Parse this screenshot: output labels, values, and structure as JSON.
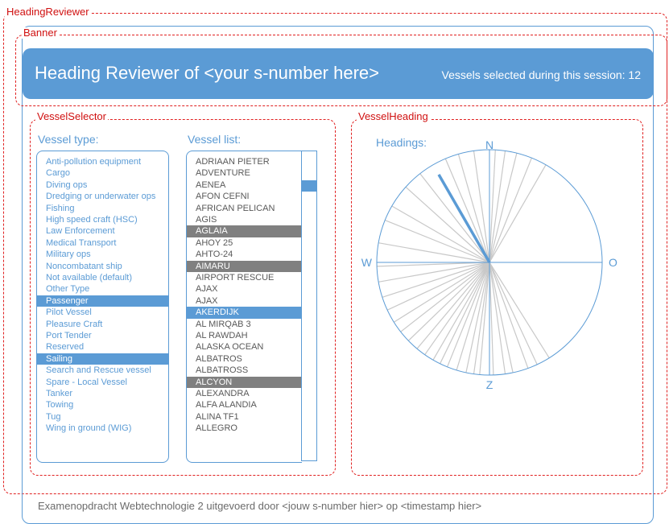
{
  "regions": {
    "outer": "HeadingReviewer",
    "banner": "Banner",
    "selector": "VesselSelector",
    "heading": "VesselHeading"
  },
  "banner": {
    "title": "Heading Reviewer of <your s-number here>",
    "session_count": "Vessels selected during this session: 12"
  },
  "selector": {
    "type_label": "Vessel type:",
    "list_label": "Vessel list:",
    "vessel_types": [
      {
        "label": "Anti-pollution equipment",
        "selected": false
      },
      {
        "label": "Cargo",
        "selected": false
      },
      {
        "label": "Diving ops",
        "selected": false
      },
      {
        "label": "Dredging or underwater ops",
        "selected": false
      },
      {
        "label": "Fishing",
        "selected": false
      },
      {
        "label": "High speed craft (HSC)",
        "selected": false
      },
      {
        "label": "Law Enforcement",
        "selected": false
      },
      {
        "label": "Medical Transport",
        "selected": false
      },
      {
        "label": "Military ops",
        "selected": false
      },
      {
        "label": "Noncombatant ship",
        "selected": false
      },
      {
        "label": "Not available (default)",
        "selected": false
      },
      {
        "label": "Other Type",
        "selected": false
      },
      {
        "label": "Passenger",
        "selected": true
      },
      {
        "label": "Pilot Vessel",
        "selected": false
      },
      {
        "label": "Pleasure Craft",
        "selected": false
      },
      {
        "label": "Port Tender",
        "selected": false
      },
      {
        "label": "Reserved",
        "selected": false
      },
      {
        "label": "Sailing",
        "selected": true
      },
      {
        "label": "Search and Rescue vessel",
        "selected": false
      },
      {
        "label": "Spare - Local Vessel",
        "selected": false
      },
      {
        "label": "Tanker",
        "selected": false
      },
      {
        "label": "Towing",
        "selected": false
      },
      {
        "label": "Tug",
        "selected": false
      },
      {
        "label": "Wing in ground (WIG)",
        "selected": false
      }
    ],
    "vessels": [
      {
        "name": "ADRIAAN PIETER",
        "state": "none"
      },
      {
        "name": "ADVENTURE",
        "state": "none"
      },
      {
        "name": "AENEA",
        "state": "none"
      },
      {
        "name": "AFON CEFNI",
        "state": "none"
      },
      {
        "name": "AFRICAN PELICAN",
        "state": "none"
      },
      {
        "name": "AGIS",
        "state": "none"
      },
      {
        "name": "AGLAIA",
        "state": "selected"
      },
      {
        "name": "AHOY 25",
        "state": "none"
      },
      {
        "name": "AHTO-24",
        "state": "none"
      },
      {
        "name": "AIMARU",
        "state": "selected"
      },
      {
        "name": "AIRPORT RESCUE",
        "state": "none"
      },
      {
        "name": "AJAX",
        "state": "none"
      },
      {
        "name": "AJAX",
        "state": "none"
      },
      {
        "name": "AKERDIJK",
        "state": "focus"
      },
      {
        "name": "AL MIRQAB 3",
        "state": "none"
      },
      {
        "name": "AL RAWDAH",
        "state": "none"
      },
      {
        "name": "ALASKA OCEAN",
        "state": "none"
      },
      {
        "name": "ALBATROS",
        "state": "none"
      },
      {
        "name": "ALBATROSS",
        "state": "none"
      },
      {
        "name": "ALCYON",
        "state": "selected"
      },
      {
        "name": "ALEXANDRA",
        "state": "none"
      },
      {
        "name": "ALFA ALANDIA",
        "state": "none"
      },
      {
        "name": "ALINA TF1",
        "state": "none"
      },
      {
        "name": "ALLEGRO",
        "state": "none"
      }
    ]
  },
  "heading_panel": {
    "label": "Headings:",
    "compass": {
      "north": "N",
      "east": "O",
      "south": "Z",
      "west": "W"
    },
    "active_heading_deg": 330,
    "headings_deg": [
      3,
      8,
      14,
      22,
      30,
      148,
      155,
      160,
      168,
      172,
      178,
      185,
      188,
      192,
      197,
      202,
      206,
      210,
      215,
      220,
      226,
      232,
      238,
      245,
      252,
      260,
      268,
      280,
      292,
      300,
      312,
      322,
      337,
      344,
      352
    ],
    "colors": {
      "line": "#c8c8c8",
      "active": "#5b9bd5",
      "circle": "#5b9bd5"
    }
  },
  "footer": {
    "text": "Examenopdracht Webtechnologie 2 uitgevoerd door <jouw s-number hier> op <timestamp hier>"
  }
}
